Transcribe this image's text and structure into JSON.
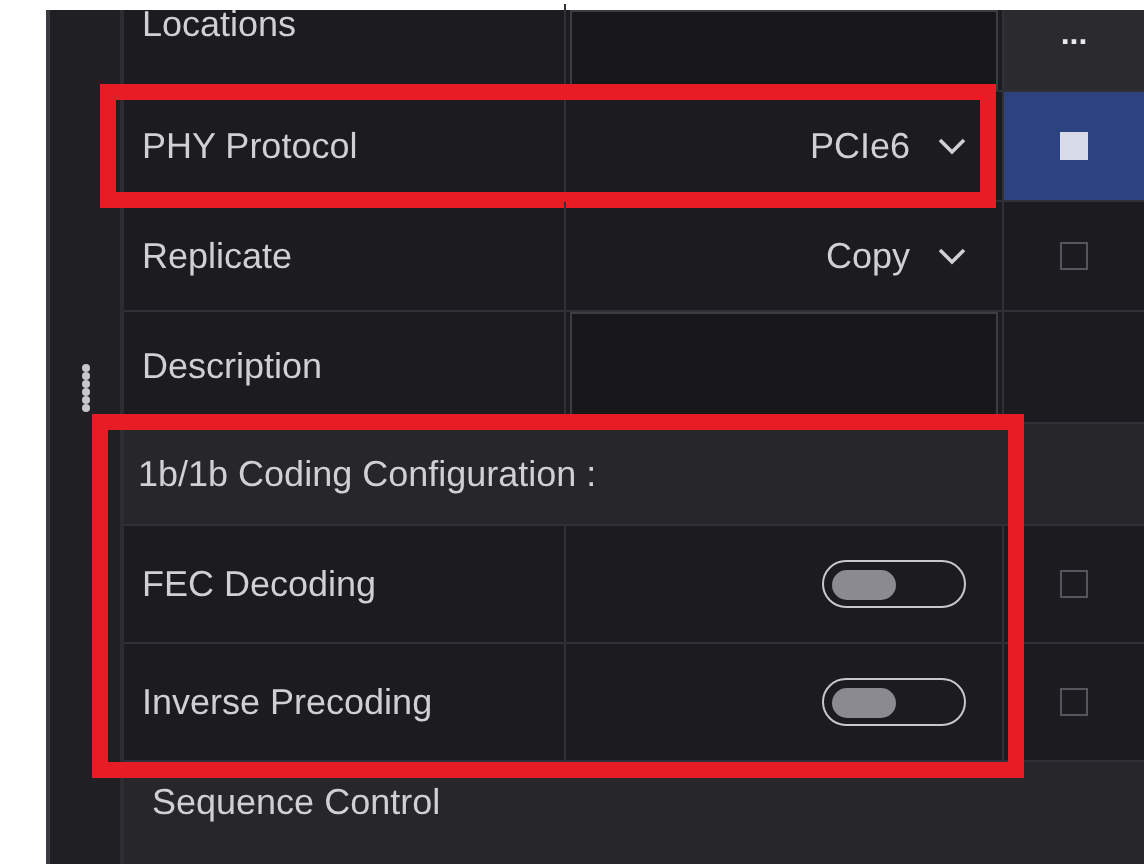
{
  "rows": [
    {
      "kind": "browse",
      "label": "Locations",
      "button": "..."
    },
    {
      "kind": "select",
      "label": "PHY Protocol",
      "value": "PCIe6",
      "checked": true,
      "highlighted": true
    },
    {
      "kind": "select",
      "label": "Replicate",
      "value": "Copy",
      "checked": false,
      "highlighted": false
    },
    {
      "kind": "text",
      "label": "Description"
    }
  ],
  "section": {
    "title": "1b/1b Coding Configuration :",
    "highlighted": true,
    "rows": [
      {
        "label": "FEC Decoding",
        "on": false,
        "checked": false
      },
      {
        "label": "Inverse Precoding",
        "on": false,
        "checked": false
      }
    ]
  },
  "next_section": {
    "title": "Sequence Control"
  }
}
